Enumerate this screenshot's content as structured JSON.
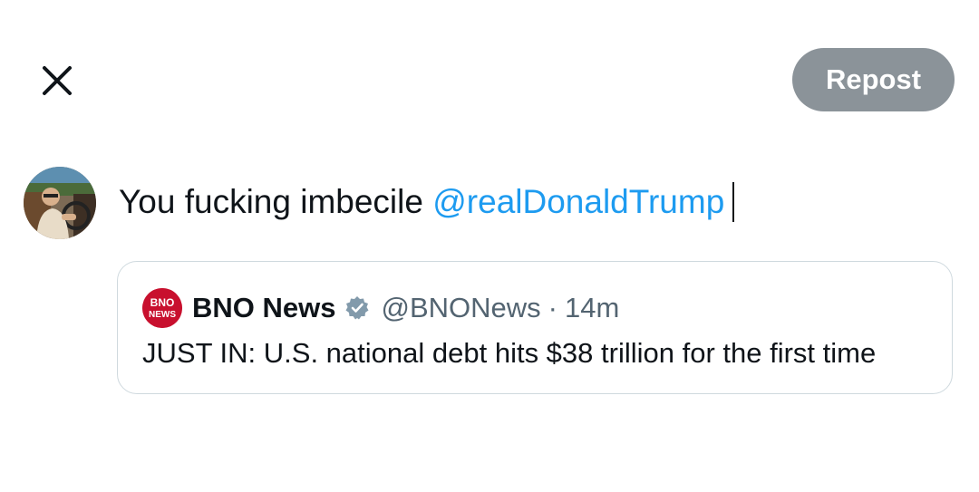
{
  "header": {
    "close_icon": "close-icon",
    "repost_label": "Repost"
  },
  "compose": {
    "avatar_icon": "user-avatar",
    "text": "You fucking imbecile ",
    "mention": "@realDonaldTrump"
  },
  "quote": {
    "logo_icon": "bno-news-logo",
    "name": "BNO News",
    "verified_icon": "verified-badge-icon",
    "handle": "@BNONews",
    "separator": "·",
    "time": "14m",
    "body": "JUST IN: U.S. national debt hits $38 trillion for the first time"
  },
  "colors": {
    "mention": "#1d9bf0",
    "repost_disabled": "#8b9399",
    "bno_red": "#c8102e",
    "border": "#cfd9de"
  }
}
